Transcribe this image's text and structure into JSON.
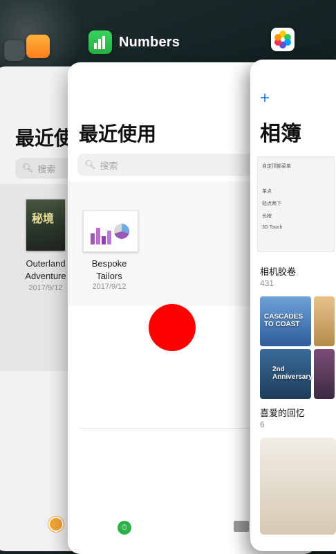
{
  "switcher": {
    "app_label": "Numbers",
    "icons": [
      "camera-icon",
      "pages-icon",
      "numbers-icon",
      "photos-icon"
    ]
  },
  "pages_card": {
    "title": "最近使",
    "search_placeholder": "搜索",
    "doc": {
      "name_line1": "Outerland",
      "name_line2": "Adventure",
      "date": "2017/9/12",
      "thumb_text": "秘境"
    }
  },
  "numbers_card": {
    "title": "最近使用",
    "search_placeholder": "搜索",
    "doc": {
      "name_line1": "Bespoke",
      "name_line2": "Tailors",
      "date": "2017/9/12"
    }
  },
  "photos_card": {
    "title": "相簿",
    "settings_lines": [
      "自定顶部菜单",
      "单点",
      "轻点两下",
      "长按",
      "3D Touch"
    ],
    "album": {
      "name": "相机胶卷",
      "count": "431"
    },
    "tile_text": {
      "t1": "CASCADES TO COAST",
      "t2": "2nd Anniversary"
    },
    "memories": {
      "name": "喜爱的回忆",
      "count": "6"
    }
  },
  "accent_colors": {
    "numbers_green": "#2bb04a",
    "pages_orange": "#f4a637",
    "photos_blue": "#1a7cf5",
    "red_dot": "#ff0000"
  }
}
